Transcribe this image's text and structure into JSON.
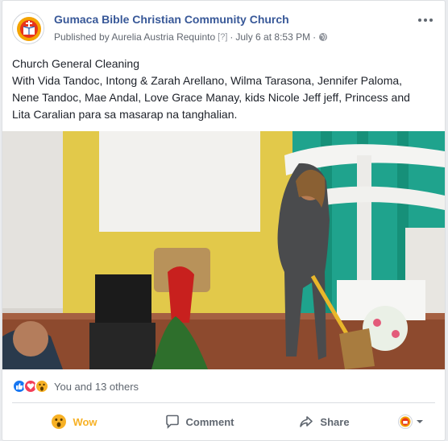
{
  "post": {
    "page_name": "Gumaca Bible Christian Community Church",
    "published_by": "Published by Aurelia Austria Requinto",
    "help_marker": "[?]",
    "separator": "·",
    "date": "July 6 at 8:53 PM",
    "privacy_icon": "globe-icon",
    "text_title": "Church General Cleaning",
    "text_body": "With Vida Tandoc, Intong & Zarah Arellano, Wilma Tarasona, Jennifer Paloma, Nene Tandoc, Mae Andal, Love Grace Manay, kids Nicole Jeff jeff, Princess and Lita Caralian para sa masarap na tanghalian."
  },
  "reactions": {
    "icons": [
      "like-icon",
      "love-icon",
      "wow-icon"
    ],
    "summary": "You and 13 others"
  },
  "actions": {
    "wow_label": "Wow",
    "comment_label": "Comment",
    "share_label": "Share"
  },
  "colors": {
    "link_blue": "#385898",
    "like_blue": "#1877f2",
    "love_red": "#f33e58",
    "wow_yellow": "#f7b125",
    "text_dark": "#1d2129",
    "text_muted": "#616770"
  }
}
